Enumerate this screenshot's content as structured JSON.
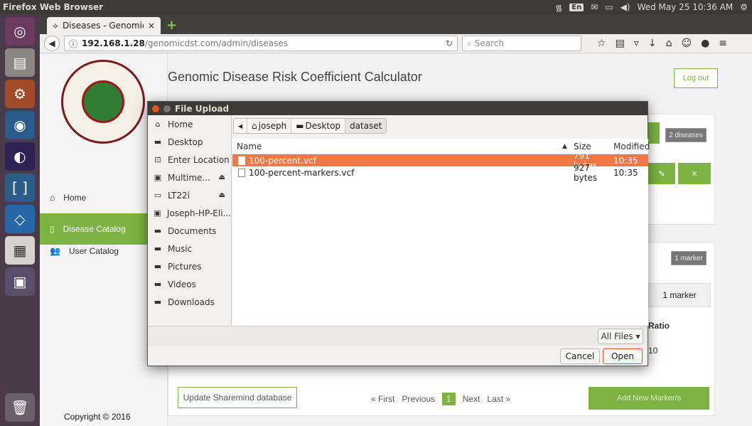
{
  "system": {
    "app_title": "Firefox Web Browser",
    "lang": "En",
    "clock": "Wed May 25 10:36 AM"
  },
  "launcher": {
    "apps": [
      "ubuntu-dash-icon",
      "files-icon",
      "settings-icon",
      "firefox-icon",
      "eclipse-icon",
      "brackets-icon",
      "virtualbox-icon",
      "calculator-icon",
      "workspace-switcher-icon",
      "trash-icon"
    ]
  },
  "browser": {
    "tab_title": "Diseases - Genomic ...",
    "url_host": "192.168.1.28",
    "url_path": "/genomicdst.com/admin/diseases",
    "search_placeholder": "Search"
  },
  "page": {
    "app_title": "Genomic Disease Risk Coefficient Calculator",
    "logout": "Log out",
    "nav": [
      {
        "label": "Home"
      },
      {
        "label": "Disease Catalog"
      },
      {
        "label": "User Catalog"
      }
    ],
    "copyright": "Copyright © 2016",
    "diseases_badge": "2 diseases",
    "edit_icon": "✎",
    "delete_icon": "✕",
    "marker_badge": "1 marker",
    "marker_box": "1 marker",
    "ratio_header": "Ratio",
    "ratio_value": "10",
    "update_btn": "Update Sharemind database",
    "pager": {
      "first": "« First",
      "prev": "Previous",
      "current": "1",
      "next": "Next",
      "last": "Last »"
    },
    "add_markers": "Add New Marker/s"
  },
  "dialog": {
    "title": "File Upload",
    "places": [
      {
        "label": "Home",
        "icon": "home-icon"
      },
      {
        "label": "Desktop",
        "icon": "folder-icon"
      },
      {
        "label": "Enter Location",
        "icon": "location-icon"
      },
      {
        "label": "Multime...",
        "icon": "drive-icon",
        "eject": true
      },
      {
        "label": "LT22i",
        "icon": "usb-drive-icon",
        "eject": true
      },
      {
        "label": "Joseph-HP-Eli...",
        "icon": "drive-icon"
      },
      {
        "label": "Documents",
        "icon": "folder-icon"
      },
      {
        "label": "Music",
        "icon": "folder-icon"
      },
      {
        "label": "Pictures",
        "icon": "folder-icon"
      },
      {
        "label": "Videos",
        "icon": "folder-icon"
      },
      {
        "label": "Downloads",
        "icon": "folder-icon"
      }
    ],
    "path": [
      "joseph",
      "Desktop",
      "dataset"
    ],
    "columns": {
      "name": "Name",
      "size": "Size",
      "modified": "Modified"
    },
    "files": [
      {
        "name": "100-percent.vcf",
        "size": "791 bytes",
        "modified": "10:35",
        "selected": true
      },
      {
        "name": "100-percent-markers.vcf",
        "size": "927 bytes",
        "modified": "10:35",
        "selected": false
      }
    ],
    "filter": "All Files",
    "cancel": "Cancel",
    "open": "Open"
  }
}
